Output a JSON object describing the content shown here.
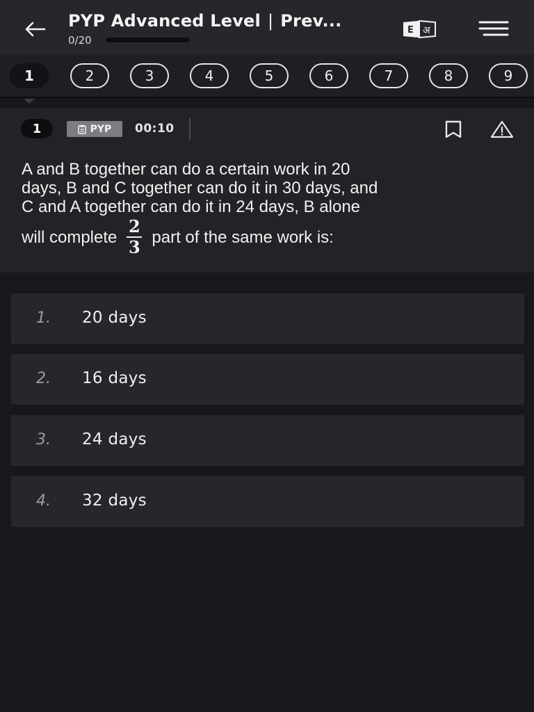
{
  "header": {
    "title": "PYP Advanced Level",
    "separator": "|",
    "title_suffix": "Prev...",
    "progress_text": "0/20",
    "progress_fraction": 0,
    "lang_toggle": {
      "english_glyph": "E",
      "hindi_glyph": "अ"
    }
  },
  "question_nav": {
    "items": [
      {
        "label": "1",
        "active": true
      },
      {
        "label": "2",
        "active": false
      },
      {
        "label": "3",
        "active": false
      },
      {
        "label": "4",
        "active": false
      },
      {
        "label": "5",
        "active": false
      },
      {
        "label": "6",
        "active": false
      },
      {
        "label": "7",
        "active": false
      },
      {
        "label": "8",
        "active": false
      },
      {
        "label": "9",
        "active": false
      }
    ]
  },
  "question": {
    "number": "1",
    "tag": "PYP",
    "timer": "00:10",
    "lines": [
      "A and B together can do a certain work in 20",
      "days, B and C together can do it in 30 days, and",
      "C and A together can do it in 24 days, B alone"
    ],
    "last_line_before": "will complete",
    "fraction": {
      "numerator": "2",
      "denominator": "3"
    },
    "last_line_after": "part of the same work is:"
  },
  "options": [
    {
      "num": "1.",
      "text": "20 days"
    },
    {
      "num": "2.",
      "text": "16 days"
    },
    {
      "num": "3.",
      "text": "24 days"
    },
    {
      "num": "4.",
      "text": "32 days"
    }
  ],
  "icons": {
    "back": "arrow-left-icon",
    "language": "language-toggle-icon",
    "menu": "hamburger-menu-icon",
    "bookmark": "bookmark-icon",
    "report": "warning-triangle-icon",
    "tag": "clipboard-icon"
  },
  "colors": {
    "background": "#17181b",
    "header": "#25272b",
    "card": "#25272b",
    "accent": "#4aa3ff"
  }
}
